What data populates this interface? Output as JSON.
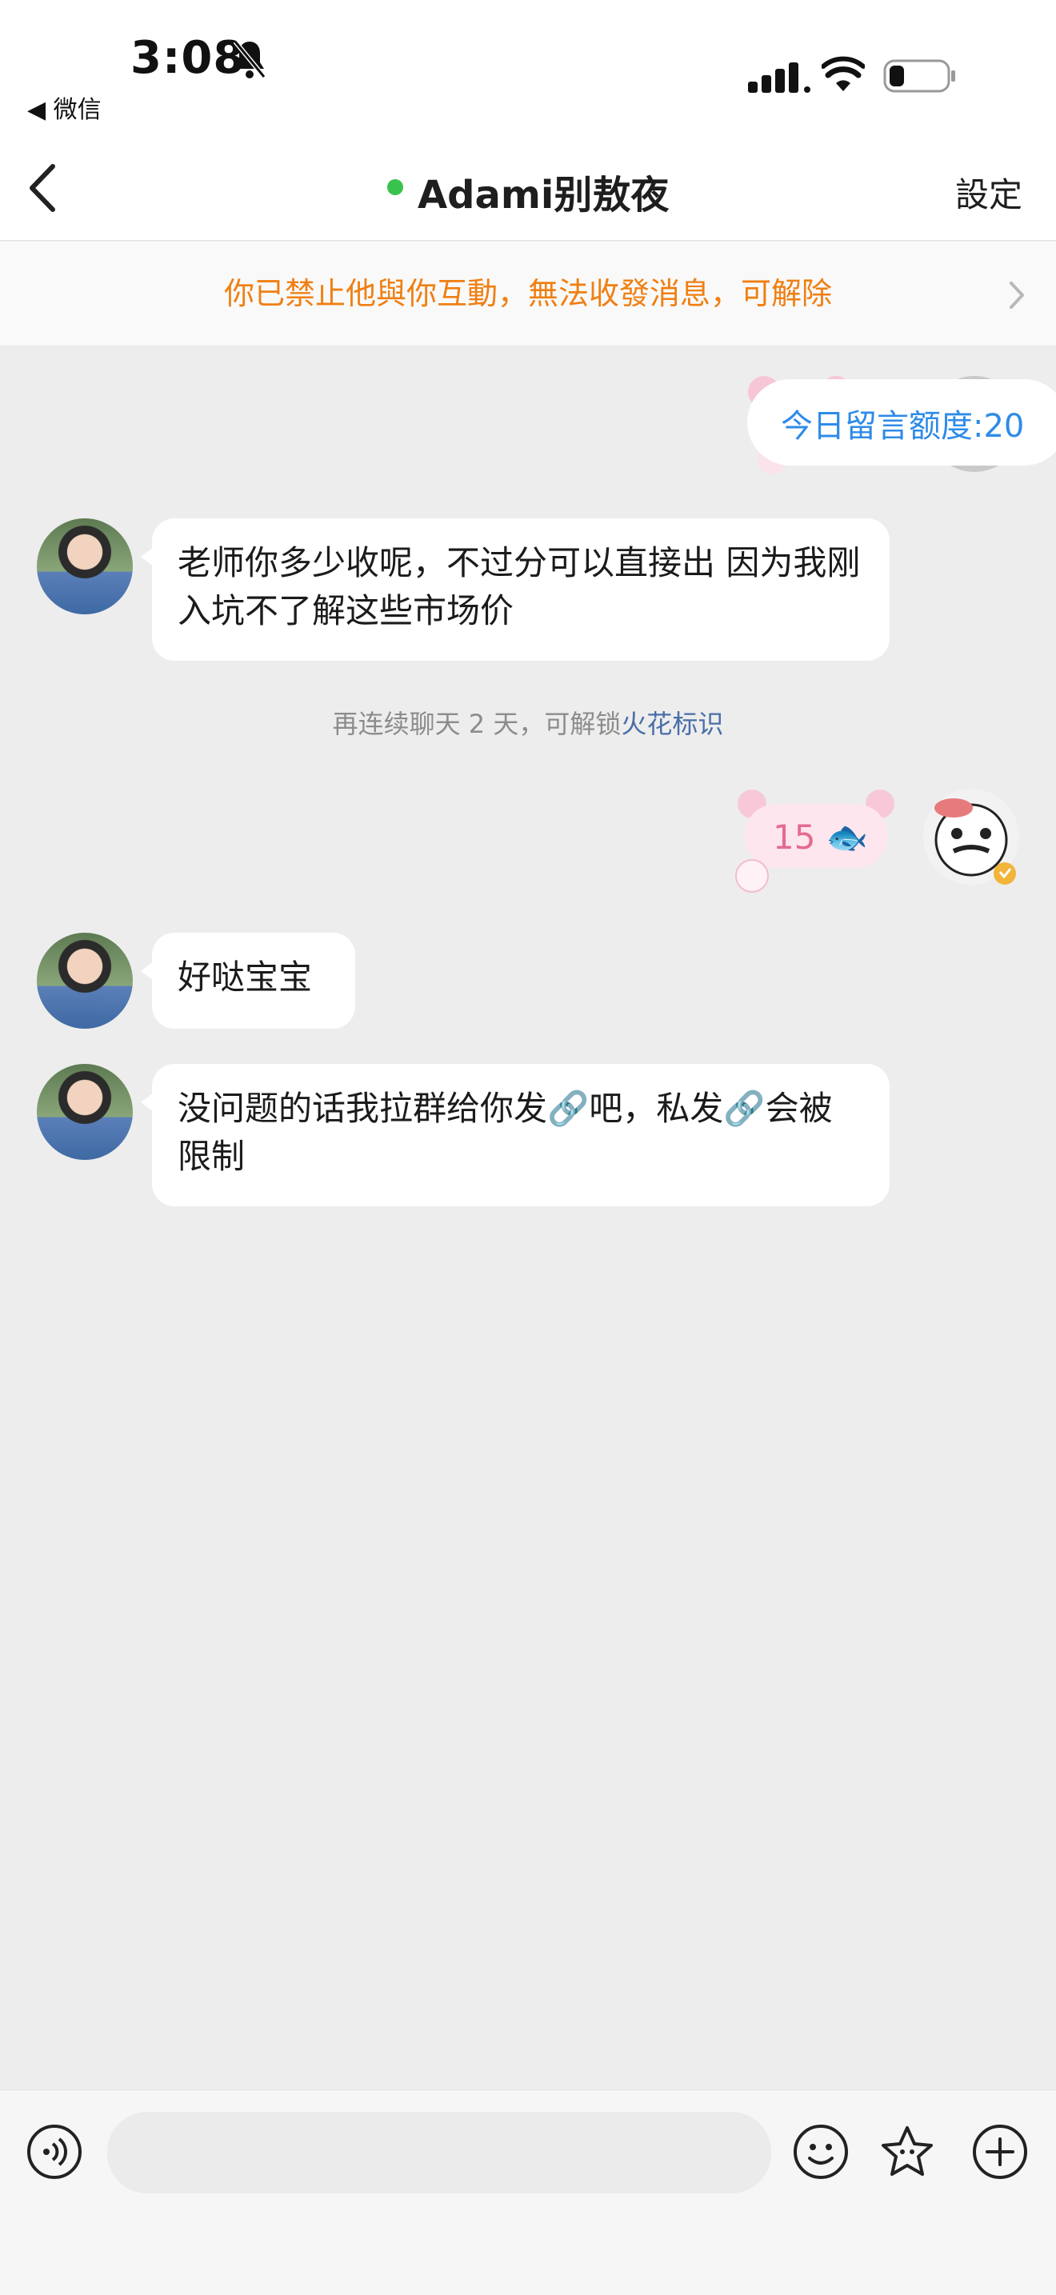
{
  "status_bar": {
    "time": "3:08",
    "back_app": "◀ 微信"
  },
  "nav": {
    "title": "Adami别敖夜",
    "settings_label": "設定",
    "online_color": "#3ac34c"
  },
  "banner": {
    "text": "你已禁止他與你互動，無法收發消息，可解除",
    "color": "#f07f12"
  },
  "quota": {
    "text": "今日留言额度:20"
  },
  "messages": [
    {
      "direction": "in",
      "text": "老师你多少收呢，不过分可以直接出 因为我刚入坑不了解这些市场价"
    },
    {
      "direction": "in",
      "text": "好哒宝宝"
    },
    {
      "direction": "in",
      "text": "没问题的话我拉群给你发🔗吧，私发🔗会被限制"
    }
  ],
  "system_message": {
    "prefix": "再连续聊天 2 天，可解锁",
    "link": "火花标识"
  },
  "sticker": {
    "text": "15",
    "emoji": "🐟"
  },
  "input": {
    "placeholder": ""
  },
  "icons": [
    "bell-slash-icon",
    "signal-icon",
    "wifi-icon",
    "battery-icon",
    "back-chevron-icon",
    "chevron-right-icon",
    "voice-icon",
    "emoji-icon",
    "sticker-icon",
    "plus-icon"
  ]
}
